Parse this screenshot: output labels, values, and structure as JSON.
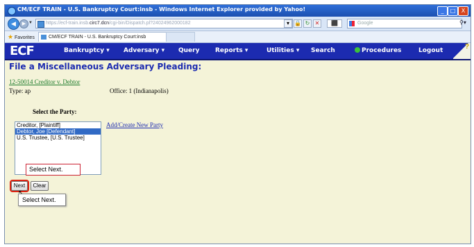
{
  "window": {
    "title": "CM/ECF TRAIN - U.S. Bankruptcy Court:insb - Windows Internet Explorer provided by Yahoo!",
    "controls": {
      "minimize": "_",
      "maximize": "□",
      "close": "X"
    }
  },
  "addressbar": {
    "url_prefix": "https://ecf-train.insb.",
    "url_host": "circ7.dcn",
    "url_path": "/cgi-bin/Dispatch.pl?24024962000182",
    "search_placeholder": "Google"
  },
  "favorites": {
    "label": "Favorites",
    "tab_title": "CM/ECF TRAIN - U.S. Bankruptcy Court:insb"
  },
  "ecf_menu": {
    "logo": "ECF",
    "items": [
      "Bankruptcy ▾",
      "Adversary ▾",
      "Query",
      "Reports ▾",
      "Utilities ▾",
      "Search",
      "Procedures",
      "Logout"
    ]
  },
  "page": {
    "title": "File a Miscellaneous Adversary Pleading:",
    "case_link": "12-50014 Creditor v. Debtor",
    "type_line": "Type: ap",
    "office_line": "Office: 1 (Indianapolis)",
    "select_party_label": "Select the Party:",
    "party_options": [
      "Creditor, [Plaintiff]",
      "Debtor, Joe [Defendant]",
      "U.S. Trustee, [U.S. Trustee]"
    ],
    "selected_index": 1,
    "add_party_link": "Add/Create New Party",
    "next_button": "Next",
    "clear_button": "Clear"
  },
  "callouts": {
    "listbox_callout": "Select Next.",
    "next_callout": "Select Next."
  }
}
